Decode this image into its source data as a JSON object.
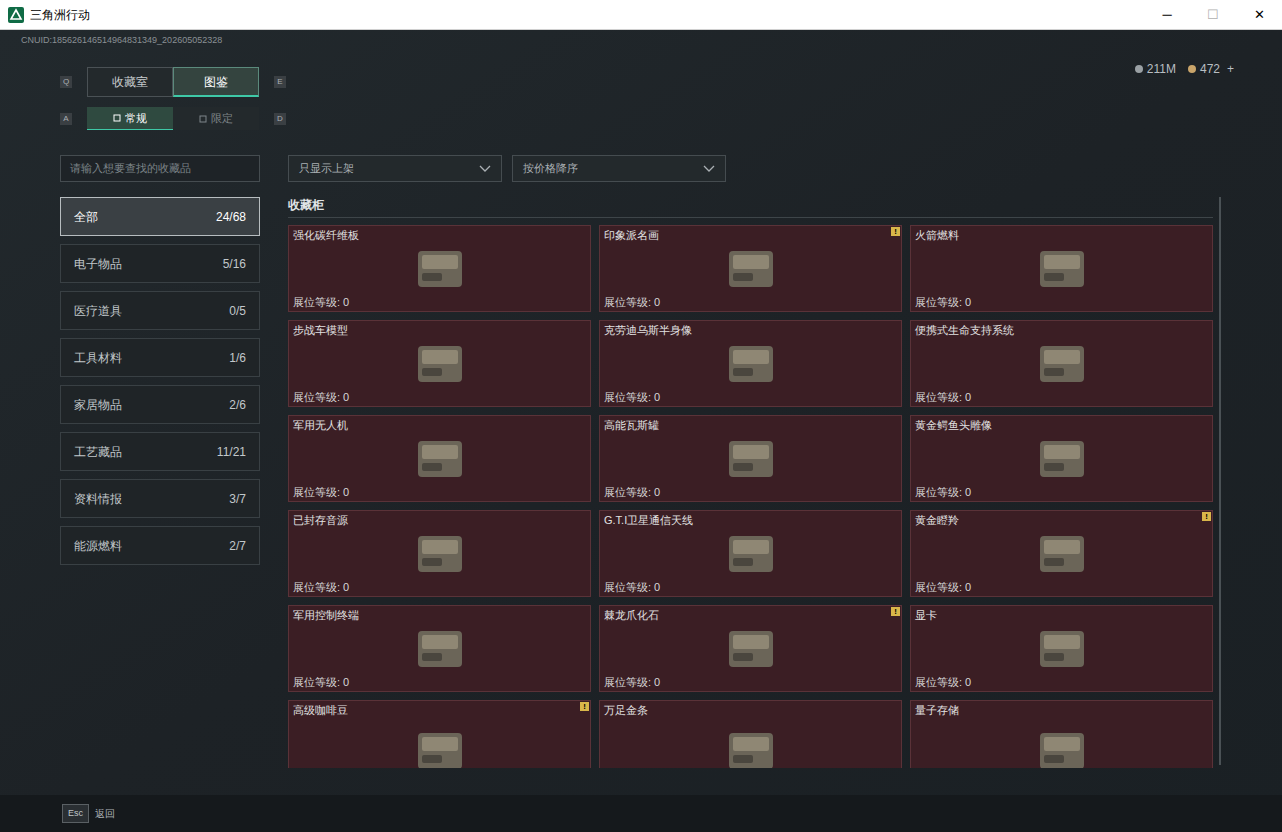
{
  "window": {
    "title": "三角洲行动",
    "controls": [
      "─",
      "☐",
      "✕"
    ]
  },
  "uid": "CNUID:185626146514964831349_202605052328",
  "currency": [
    {
      "value": "211M",
      "plus": ""
    },
    {
      "value": "472",
      "plus": "+"
    }
  ],
  "tabs": {
    "key_left": "Q",
    "key_right": "E",
    "items": [
      {
        "label": "收藏室",
        "selected": false
      },
      {
        "label": "图鉴",
        "selected": true
      }
    ]
  },
  "subtabs": {
    "key_left": "A",
    "key_right": "D",
    "items": [
      {
        "label": "常规",
        "selected": true
      },
      {
        "label": "限定",
        "selected": false
      }
    ]
  },
  "search": {
    "placeholder": "请输入想要查找的收藏品"
  },
  "filters": [
    {
      "label": "只显示上架"
    },
    {
      "label": "按价格降序"
    }
  ],
  "categories": [
    {
      "name": "全部",
      "count": "24/68",
      "selected": true
    },
    {
      "name": "电子物品",
      "count": "5/16",
      "selected": false
    },
    {
      "name": "医疗道具",
      "count": "0/5",
      "selected": false
    },
    {
      "name": "工具材料",
      "count": "1/6",
      "selected": false
    },
    {
      "name": "家居物品",
      "count": "2/6",
      "selected": false
    },
    {
      "name": "工艺藏品",
      "count": "11/21",
      "selected": false
    },
    {
      "name": "资料情报",
      "count": "3/7",
      "selected": false
    },
    {
      "name": "能源燃料",
      "count": "2/7",
      "selected": false
    }
  ],
  "section_title": "收藏柜",
  "alert_mark": "!",
  "items": [
    {
      "name": "强化碳纤维板",
      "level": "展位等级: 0",
      "alert": false
    },
    {
      "name": "印象派名画",
      "level": "展位等级: 0",
      "alert": true
    },
    {
      "name": "火箭燃料",
      "level": "展位等级: 0",
      "alert": false
    },
    {
      "name": "步战车模型",
      "level": "展位等级: 0",
      "alert": false
    },
    {
      "name": "克劳迪乌斯半身像",
      "level": "展位等级: 0",
      "alert": false
    },
    {
      "name": "便携式生命支持系统",
      "level": "展位等级: 0",
      "alert": false
    },
    {
      "name": "军用无人机",
      "level": "展位等级: 0",
      "alert": false
    },
    {
      "name": "高能瓦斯罐",
      "level": "展位等级: 0",
      "alert": false
    },
    {
      "name": "黄金鳄鱼头雕像",
      "level": "展位等级: 0",
      "alert": false
    },
    {
      "name": "已封存音源",
      "level": "展位等级: 0",
      "alert": false
    },
    {
      "name": "G.T.I卫星通信天线",
      "level": "展位等级: 0",
      "alert": false
    },
    {
      "name": "黄金瞪羚",
      "level": "展位等级: 0",
      "alert": true
    },
    {
      "name": "军用控制终端",
      "level": "展位等级: 0",
      "alert": false
    },
    {
      "name": "棘龙爪化石",
      "level": "展位等级: 0",
      "alert": true
    },
    {
      "name": "显卡",
      "level": "展位等级: 0",
      "alert": false
    },
    {
      "name": "高级咖啡豆",
      "level": null,
      "alert": true
    },
    {
      "name": "万足金条",
      "level": null,
      "alert": false
    },
    {
      "name": "量子存储",
      "level": null,
      "alert": false
    }
  ],
  "bottom": {
    "key": "Esc",
    "label": "返回"
  }
}
